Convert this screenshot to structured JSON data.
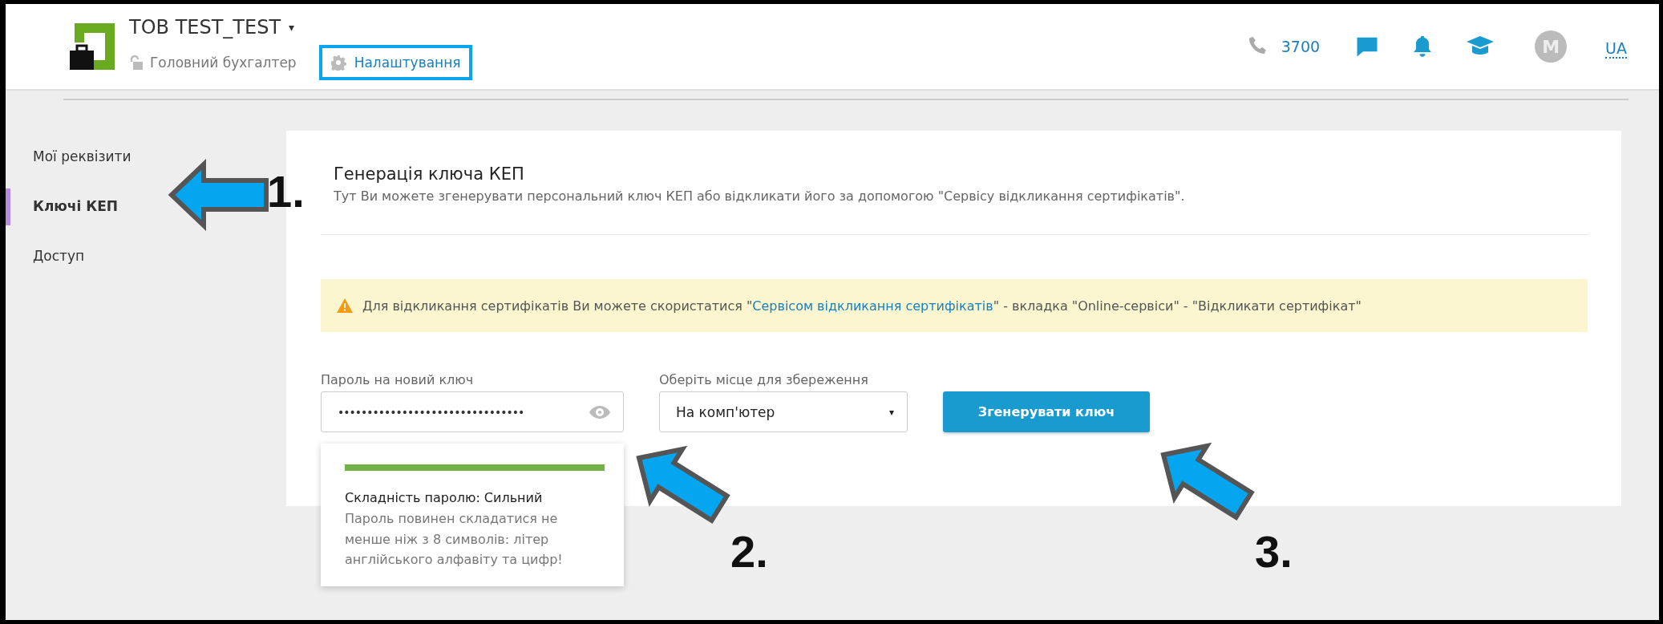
{
  "header": {
    "company": "ТОВ TEST_TEST",
    "company_caret": "▾",
    "role": "Головний бухгалтер",
    "settings_link": {
      "label": "Налаштування",
      "highlighted": true
    },
    "phone": "3700",
    "avatar": "M",
    "language": {
      "label": "UA",
      "selected": true
    }
  },
  "sidebar": {
    "items": [
      {
        "label": "Мої реквізити",
        "selected": false
      },
      {
        "label": "Ключі КЕП",
        "selected": true
      },
      {
        "label": "Доступ",
        "selected": false
      }
    ]
  },
  "card": {
    "title": "Генерація ключа КЕП",
    "description": "Тут Ви можете згенерувати персональний ключ КЕП або відкликати його за допомогою \"Сервісу відкликання сертифікатів\".",
    "notice": {
      "before": "Для відкликання сертифікатів Ви можете скористатися \"",
      "link": "Сервісом відкликання сертифікатів",
      "after": "\" - вкладка \"Online-сервіси\" - \"Відкликати сертифікат\""
    },
    "password": {
      "label": "Пароль на новий ключ",
      "value": "••••••••••••••••••••••••••••••••"
    },
    "strength": {
      "level": 1,
      "label": "Складність паролю: Сильний",
      "hint": "Пароль повинен складатися не менше ніж з 8 символів: літер англійського алфавіту та цифр!"
    },
    "storage": {
      "label": "Оберіть місце для збереження",
      "value": "На комп'ютер",
      "caret": "▾"
    },
    "generate_button": "Згенерувати ключ"
  },
  "annotations": [
    {
      "number": "1."
    },
    {
      "number": "2."
    },
    {
      "number": "3."
    }
  ]
}
